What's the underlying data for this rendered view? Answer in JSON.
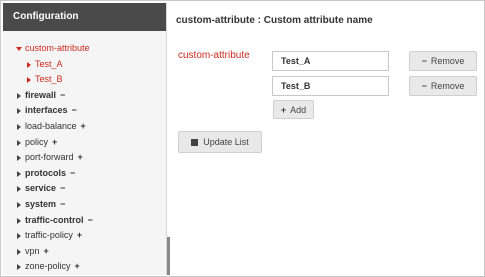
{
  "sidebar": {
    "title": "Configuration",
    "items": [
      {
        "label": "custom-attribute",
        "symbol": "",
        "expanded": true,
        "red": true,
        "bold": false,
        "child": false
      },
      {
        "label": "Test_A",
        "symbol": "",
        "expanded": false,
        "red": true,
        "bold": false,
        "child": true
      },
      {
        "label": "Test_B",
        "symbol": "",
        "expanded": false,
        "red": true,
        "bold": false,
        "child": true
      },
      {
        "label": "firewall",
        "symbol": "−",
        "expanded": false,
        "red": false,
        "bold": true,
        "child": false
      },
      {
        "label": "interfaces",
        "symbol": "−",
        "expanded": false,
        "red": false,
        "bold": true,
        "child": false
      },
      {
        "label": "load-balance",
        "symbol": "+",
        "expanded": false,
        "red": false,
        "bold": false,
        "child": false
      },
      {
        "label": "policy",
        "symbol": "+",
        "expanded": false,
        "red": false,
        "bold": false,
        "child": false
      },
      {
        "label": "port-forward",
        "symbol": "+",
        "expanded": false,
        "red": false,
        "bold": false,
        "child": false
      },
      {
        "label": "protocols",
        "symbol": "−",
        "expanded": false,
        "red": false,
        "bold": true,
        "child": false
      },
      {
        "label": "service",
        "symbol": "−",
        "expanded": false,
        "red": false,
        "bold": true,
        "child": false
      },
      {
        "label": "system",
        "symbol": "−",
        "expanded": false,
        "red": false,
        "bold": true,
        "child": false
      },
      {
        "label": "traffic-control",
        "symbol": "−",
        "expanded": false,
        "red": false,
        "bold": true,
        "child": false
      },
      {
        "label": "traffic-policy",
        "symbol": "+",
        "expanded": false,
        "red": false,
        "bold": false,
        "child": false
      },
      {
        "label": "vpn",
        "symbol": "+",
        "expanded": false,
        "red": false,
        "bold": false,
        "child": false
      },
      {
        "label": "zone-policy",
        "symbol": "+",
        "expanded": false,
        "red": false,
        "bold": false,
        "child": false
      }
    ]
  },
  "main": {
    "title": "custom-attribute : Custom attribute name",
    "attribute_label": "custom-attribute",
    "values": [
      "Test_A",
      "Test_B"
    ],
    "remove_label": "Remove",
    "remove_symbol": "−",
    "add_label": "Add",
    "add_symbol": "+",
    "update_label": "Update List"
  },
  "colors": {
    "header_bg": "#4a4a4a",
    "accent_red": "#cc2a1f",
    "button_bg": "#e9e9e9"
  }
}
